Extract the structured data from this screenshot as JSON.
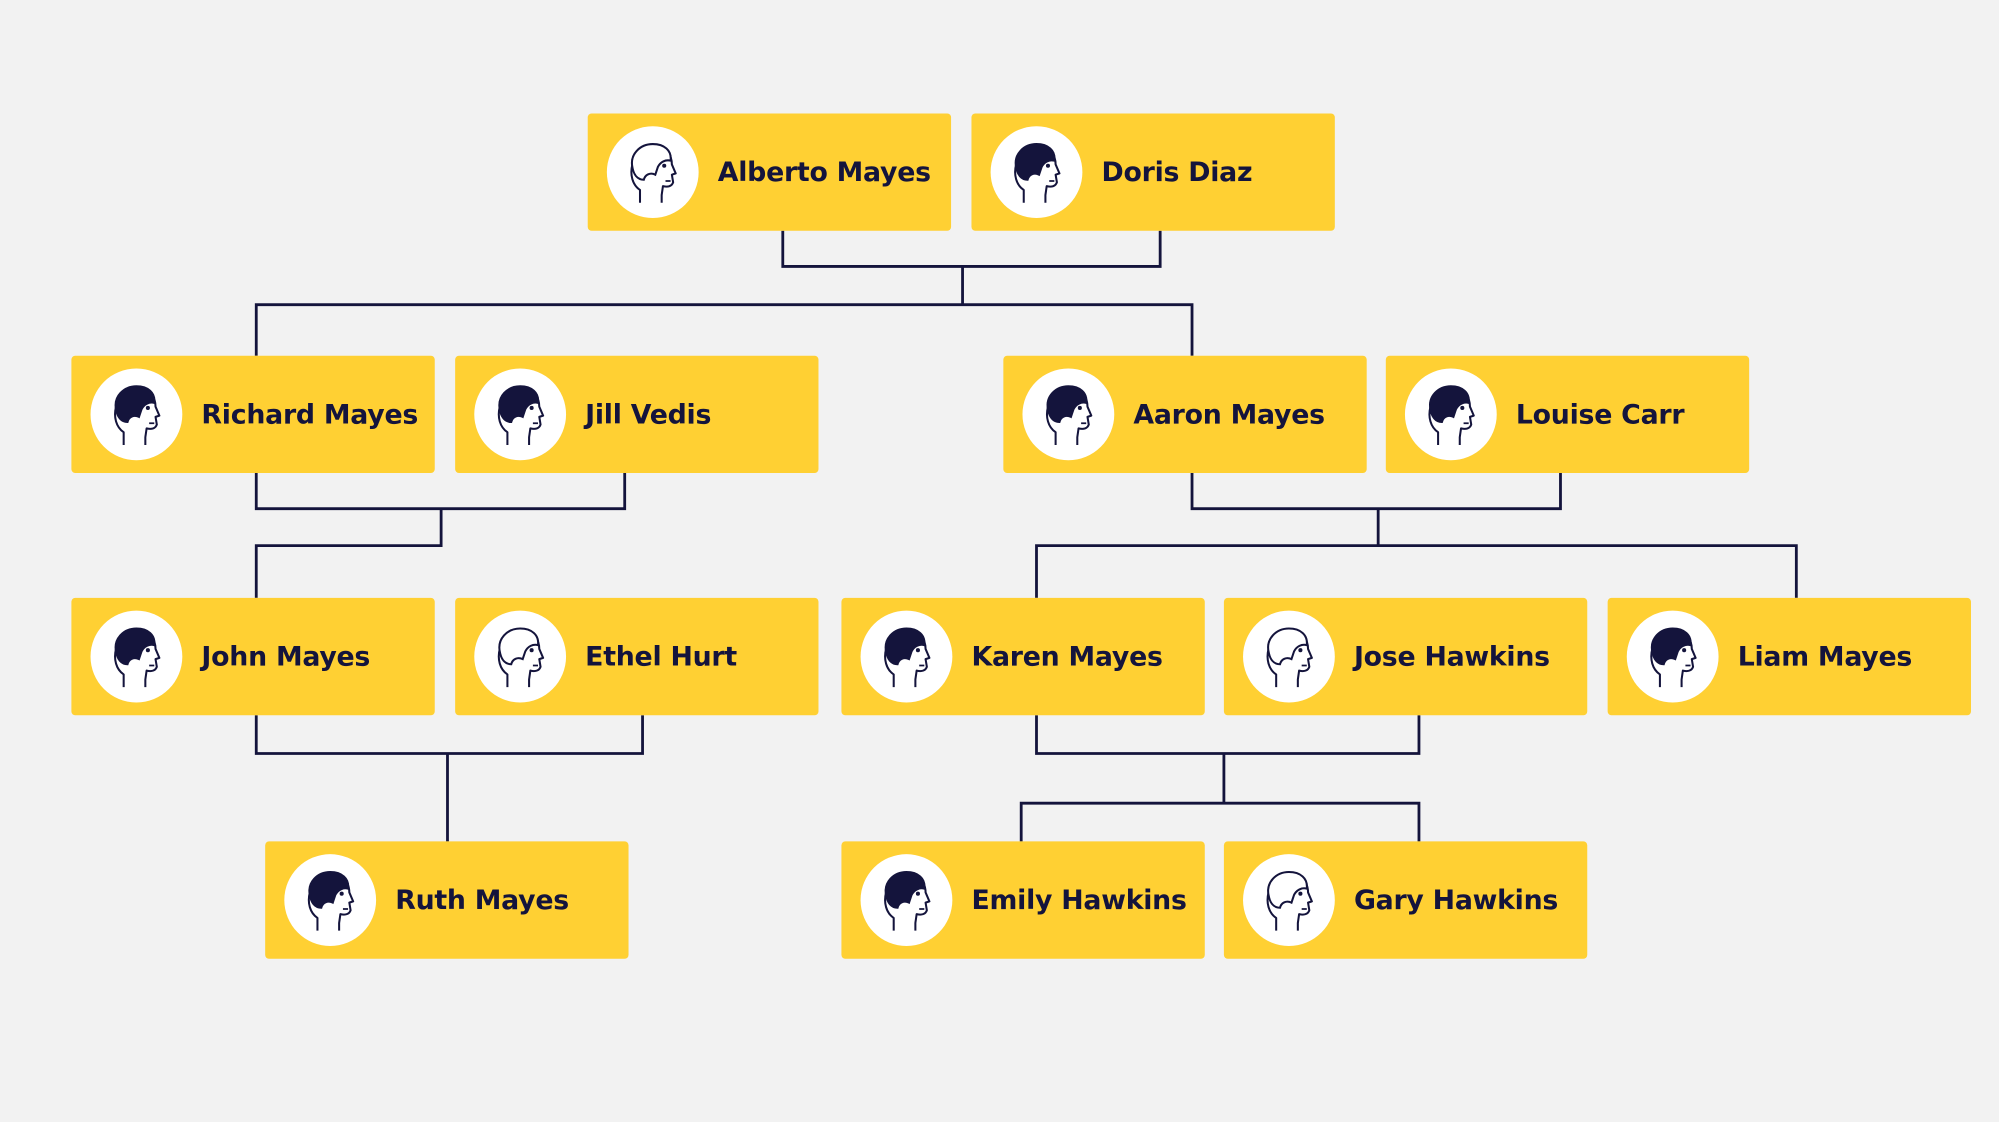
{
  "colors": {
    "background": "#F2F2F2",
    "card": "#FFD033",
    "line": "#14143C",
    "text": "#14143C"
  },
  "people": [
    {
      "id": "alberto",
      "name": "Alberto Mayes",
      "icon": "bearded-man-avatar-icon",
      "hair": "light"
    },
    {
      "id": "doris",
      "name": "Doris Diaz",
      "icon": "woman-bun-avatar-icon",
      "hair": "dark"
    },
    {
      "id": "richard",
      "name": "Richard Mayes",
      "icon": "man-avatar-icon",
      "hair": "dark"
    },
    {
      "id": "jill",
      "name": "Jill Vedis",
      "icon": "curly-woman-avatar-icon",
      "hair": "dark"
    },
    {
      "id": "aaron",
      "name": "Aaron Mayes",
      "icon": "man-avatar-icon",
      "hair": "dark"
    },
    {
      "id": "louise",
      "name": "Louise Carr",
      "icon": "woman-bob-avatar-icon",
      "hair": "dark"
    },
    {
      "id": "john",
      "name": "John Mayes",
      "icon": "man-avatar-icon",
      "hair": "dark"
    },
    {
      "id": "ethel",
      "name": "Ethel Hurt",
      "icon": "old-woman-avatar-icon",
      "hair": "light"
    },
    {
      "id": "karen",
      "name": "Karen Mayes",
      "icon": "woman-glasses-avatar-icon",
      "hair": "dark"
    },
    {
      "id": "jose",
      "name": "Jose Hawkins",
      "icon": "man-avatar-icon",
      "hair": "light"
    },
    {
      "id": "liam",
      "name": "Liam Mayes",
      "icon": "man-avatar-icon",
      "hair": "dark"
    },
    {
      "id": "ruth",
      "name": "Ruth Mayes",
      "icon": "person-glasses-avatar-icon",
      "hair": "dark"
    },
    {
      "id": "emily",
      "name": "Emily Hawkins",
      "icon": "woman-avatar-icon",
      "hair": "dark"
    },
    {
      "id": "gary",
      "name": "Gary Hawkins",
      "icon": "man-avatar-icon",
      "hair": "light"
    }
  ]
}
